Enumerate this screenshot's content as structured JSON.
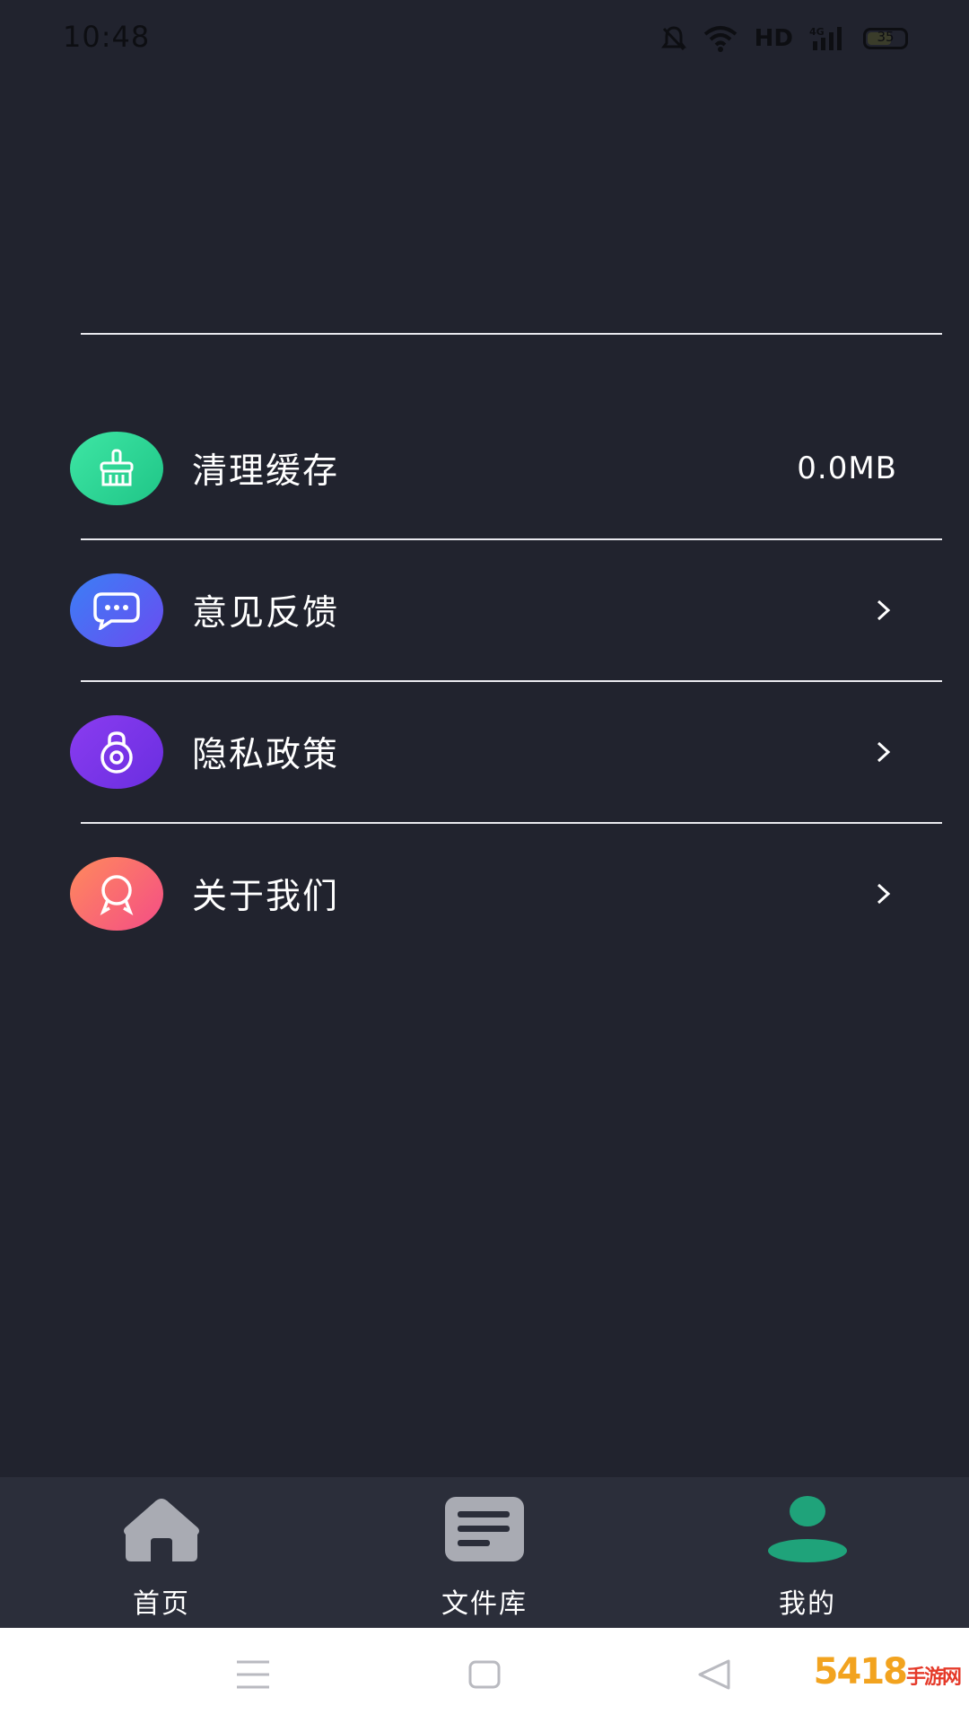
{
  "status_bar": {
    "time": "10:48",
    "network": "HD",
    "battery": "35"
  },
  "menu": {
    "items": [
      {
        "label": "清理缓存",
        "value": "0.0MB",
        "icon": "broom-icon",
        "color": "#2fd497"
      },
      {
        "label": "意见反馈",
        "chevron": ">",
        "icon": "chat-bubble-icon",
        "color": "#4f6cf3"
      },
      {
        "label": "隐私政策",
        "chevron": ">",
        "icon": "lock-icon",
        "color": "#7a35ea"
      },
      {
        "label": "关于我们",
        "chevron": ">",
        "icon": "badge-icon",
        "color": "#f76a6f"
      }
    ]
  },
  "tab_bar": {
    "tabs": [
      {
        "label": "首页",
        "icon": "home-icon",
        "active": false
      },
      {
        "label": "文件库",
        "icon": "document-list-icon",
        "active": false
      },
      {
        "label": "我的",
        "icon": "person-icon",
        "active": true
      }
    ],
    "active_color": "#1fa37a",
    "inactive_color": "#a9abb3"
  },
  "watermark": {
    "text": "5418",
    "suffix": "手游网"
  }
}
